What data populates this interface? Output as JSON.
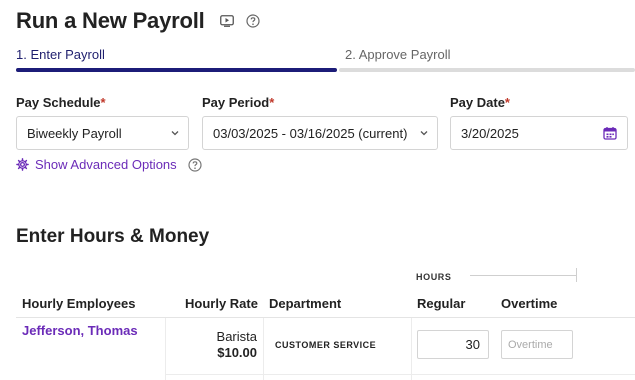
{
  "header": {
    "title": "Run a New Payroll",
    "icons": [
      "video-play-icon",
      "help-icon"
    ]
  },
  "steps": [
    {
      "label": "1. Enter Payroll",
      "active": true
    },
    {
      "label": "2. Approve Payroll",
      "active": false
    }
  ],
  "form": {
    "pay_schedule": {
      "label": "Pay Schedule",
      "required_mark": "*",
      "value": "Biweekly Payroll"
    },
    "pay_period": {
      "label": "Pay Period",
      "required_mark": "*",
      "value": "03/03/2025 - 03/16/2025 (current)"
    },
    "pay_date": {
      "label": "Pay Date",
      "required_mark": "*",
      "value": "3/20/2025"
    },
    "advanced_options_label": "Show Advanced Options"
  },
  "hours_section": {
    "title": "Enter Hours & Money",
    "group_label": "HOURS",
    "columns": [
      "Hourly Employees",
      "Hourly Rate",
      "Department",
      "Regular",
      "Overtime"
    ],
    "rows": [
      {
        "employee": "Jefferson, Thomas",
        "job_title": "Barista",
        "rate": "$10.00",
        "department": "CUSTOMER SERVICE",
        "regular": "30",
        "overtime_placeholder": "Overtime"
      }
    ]
  },
  "colors": {
    "accent_purple": "#6b2bb8",
    "progress_active": "#1c1c78",
    "progress_inactive": "#dcdcdc",
    "required": "#c0392b"
  }
}
